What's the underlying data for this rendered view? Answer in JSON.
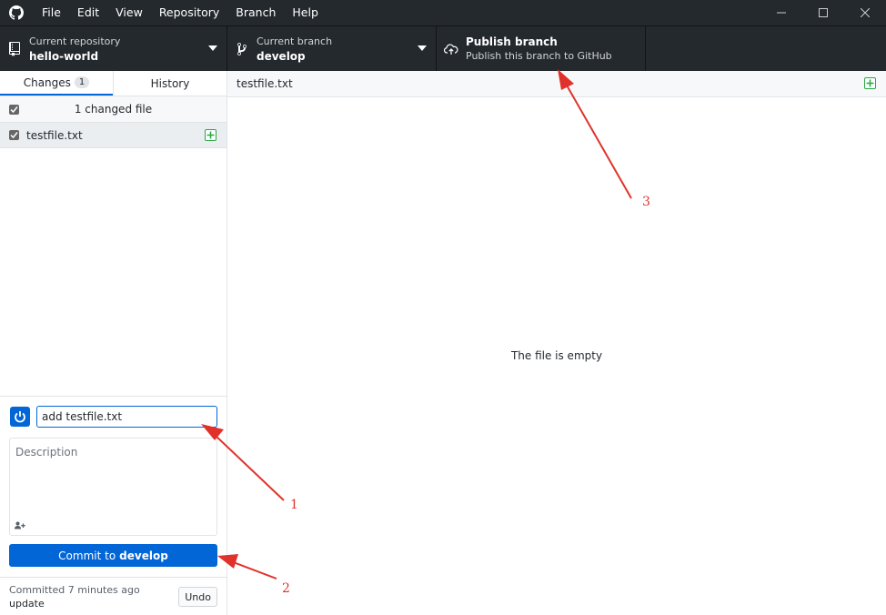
{
  "menu": {
    "items": [
      "File",
      "Edit",
      "View",
      "Repository",
      "Branch",
      "Help"
    ]
  },
  "toolbar": {
    "repo_label": "Current repository",
    "repo_value": "hello-world",
    "branch_label": "Current branch",
    "branch_value": "develop",
    "publish_title": "Publish branch",
    "publish_subtitle": "Publish this branch to GitHub"
  },
  "sidebar": {
    "tab_changes": "Changes",
    "tab_changes_count": "1",
    "tab_history": "History",
    "changed_files_label": "1 changed file",
    "files": [
      {
        "name": "testfile.txt",
        "status": "added"
      }
    ]
  },
  "commit": {
    "summary_value": "add testfile.txt",
    "description_placeholder": "Description",
    "button_prefix": "Commit to",
    "button_branch": "develop"
  },
  "last_commit": {
    "time": "Committed 7 minutes ago",
    "message": "update",
    "undo_label": "Undo"
  },
  "diff": {
    "filename": "testfile.txt",
    "empty_message": "The file is empty"
  },
  "annotations": {
    "labels": [
      "1",
      "2",
      "3"
    ],
    "color": "#e0322b"
  },
  "colors": {
    "toolbar_bg": "#24292e",
    "accent": "#0366d6",
    "added": "#28a745"
  }
}
